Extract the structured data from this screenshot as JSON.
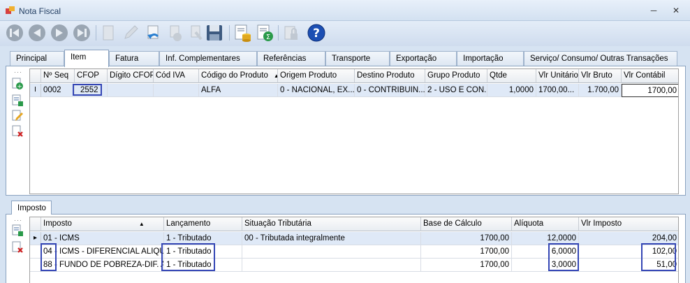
{
  "window": {
    "title": "Nota Fiscal",
    "minimize": "─",
    "close": "✕"
  },
  "toolbar": {
    "icons": [
      "first-record-icon",
      "previous-record-icon",
      "next-record-icon",
      "last-record-icon",
      "new-document-icon",
      "edit-pencil-icon",
      "undo-icon",
      "cancel-icon",
      "pointer-icon",
      "save-icon",
      "database-stack-icon",
      "calculate-sigma-icon",
      "lock-icon",
      "help-icon"
    ]
  },
  "tabs": [
    {
      "label": "Principal"
    },
    {
      "label": "Item"
    },
    {
      "label": "Fatura"
    },
    {
      "label": "Inf. Complementares"
    },
    {
      "label": "Referências"
    },
    {
      "label": "Transporte"
    },
    {
      "label": "Exportação"
    },
    {
      "label": "Importação"
    },
    {
      "label": "Serviço/ Consumo/ Outras Transações"
    }
  ],
  "items_grid": {
    "indicator": "I",
    "columns": [
      "Nº Seq",
      "CFOP",
      "Dígito CFOP",
      "Cód IVA",
      "Código do Produto",
      "Origem Produto",
      "Destino Produto",
      "Grupo Produto",
      "Qtde",
      "Vlr Unitário",
      "Vlr Bruto",
      "Vlr Contábil"
    ],
    "rows": [
      [
        "0002",
        "2552",
        "",
        "",
        "ALFA",
        "0 - NACIONAL, EX...",
        "0 - CONTRIBUIN...",
        "2 - USO E CON...",
        "1,0000",
        "1700,00...",
        "1.700,00",
        "1700,00"
      ]
    ]
  },
  "subtab": {
    "label": "Imposto"
  },
  "tax_grid": {
    "columns": [
      "Imposto",
      "Lançamento",
      "Situação Tributária",
      "Base de Cálculo",
      "Alíquota",
      "Vlr Imposto"
    ],
    "indicator": "▸",
    "rows": [
      [
        "01 - ICMS",
        "1 - Tributado",
        "00 - Tributada integralmente",
        "1700,00",
        "12,0000",
        "204,00"
      ],
      [
        "04 - ICMS - DIFERENCIAL ALIQU...",
        "1 - Tributado",
        "",
        "1700,00",
        "6,0000",
        "102,00"
      ],
      [
        "88 - FUNDO DE POBREZA-DIF. A...",
        "1 - Tributado",
        "",
        "1700,00",
        "3,0000",
        "51,00"
      ]
    ]
  },
  "colors": {
    "highlight_box": "#3446b5",
    "selected_row": "#dfe9f7"
  }
}
